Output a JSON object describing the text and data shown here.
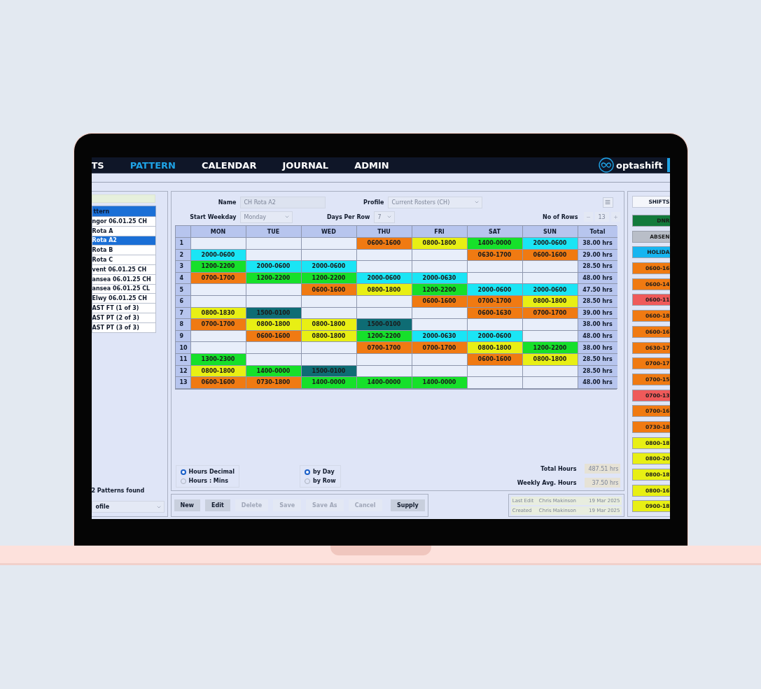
{
  "nav": {
    "items": [
      {
        "label": "TS",
        "selected": false
      },
      {
        "label": "PATTERN",
        "selected": true
      },
      {
        "label": "CALENDAR",
        "selected": false
      },
      {
        "label": "JOURNAL",
        "selected": false
      },
      {
        "label": "ADMIN",
        "selected": false
      }
    ],
    "logo": "optashift"
  },
  "pattern_list": {
    "header": "ttern",
    "items": [
      {
        "label": "ngor 06.01.25 CH",
        "selected": false
      },
      {
        "label": "Rota A",
        "selected": false
      },
      {
        "label": "Rota A2",
        "selected": true
      },
      {
        "label": "Rota B",
        "selected": false
      },
      {
        "label": "Rota C",
        "selected": false
      },
      {
        "label": "vent 06.01.25 CH",
        "selected": false
      },
      {
        "label": "ansea 06.01.25 CH",
        "selected": false
      },
      {
        "label": "ansea 06.01.25 CL",
        "selected": false
      },
      {
        "label": "Elwy 06.01.25 CH",
        "selected": false
      },
      {
        "label": "AST FT (1 of 3)",
        "selected": false
      },
      {
        "label": "AST PT (2 of 3)",
        "selected": false
      },
      {
        "label": "AST PT (3 of 3)",
        "selected": false
      }
    ],
    "count": "2 Patterns found",
    "profile_select": "ofile"
  },
  "form": {
    "name_label": "Name",
    "name": "CH Rota A2",
    "profile_label": "Profile",
    "profile": "Current Rosters (CH)",
    "start_weekday_label": "Start Weekday",
    "start_weekday": "Monday",
    "days_per_row_label": "Days Per Row",
    "days_per_row": "7",
    "rows_label": "No of Rows",
    "rows": "13"
  },
  "grid": {
    "columns": [
      "MON",
      "TUE",
      "WED",
      "THU",
      "FRI",
      "SAT",
      "SUN",
      "Total"
    ],
    "rows": [
      {
        "label": "1",
        "cells": [
          null,
          null,
          null,
          {
            "shift": "0600-1600",
            "color": "#f07a12"
          },
          {
            "shift": "0800-1800",
            "color": "#e8ef14"
          },
          {
            "shift": "1400-0000",
            "color": "#16e02a"
          },
          {
            "shift": "2000-0600",
            "color": "#1ae5f5"
          }
        ],
        "total": "38.00 hrs"
      },
      {
        "label": "2",
        "cells": [
          {
            "shift": "2000-0600",
            "color": "#1ae5f5"
          },
          null,
          null,
          null,
          null,
          {
            "shift": "0630-1700",
            "color": "#f07a12"
          },
          {
            "shift": "0600-1600",
            "color": "#f07a12"
          }
        ],
        "total": "29.00 hrs"
      },
      {
        "label": "3",
        "cells": [
          {
            "shift": "1200-2200",
            "color": "#16e02a"
          },
          {
            "shift": "2000-0600",
            "color": "#1ae5f5"
          },
          {
            "shift": "2000-0600",
            "color": "#1ae5f5"
          },
          null,
          null,
          null,
          null
        ],
        "total": "28.50 hrs"
      },
      {
        "label": "4",
        "cells": [
          {
            "shift": "0700-1700",
            "color": "#f07a12"
          },
          {
            "shift": "1200-2200",
            "color": "#16e02a"
          },
          {
            "shift": "1200-2200",
            "color": "#16e02a"
          },
          {
            "shift": "2000-0600",
            "color": "#1ae5f5"
          },
          {
            "shift": "2000-0630",
            "color": "#1ae5f5"
          },
          null,
          null
        ],
        "total": "48.00 hrs"
      },
      {
        "label": "5",
        "cells": [
          null,
          null,
          {
            "shift": "0600-1600",
            "color": "#f07a12"
          },
          {
            "shift": "0800-1800",
            "color": "#e8ef14"
          },
          {
            "shift": "1200-2200",
            "color": "#16e02a"
          },
          {
            "shift": "2000-0600",
            "color": "#1ae5f5"
          },
          {
            "shift": "2000-0600",
            "color": "#1ae5f5"
          }
        ],
        "total": "47.50 hrs"
      },
      {
        "label": "6",
        "cells": [
          null,
          null,
          null,
          null,
          {
            "shift": "0600-1600",
            "color": "#f07a12"
          },
          {
            "shift": "0700-1700",
            "color": "#f07a12"
          },
          {
            "shift": "0800-1800",
            "color": "#e8ef14"
          }
        ],
        "total": "28.50 hrs"
      },
      {
        "label": "7",
        "cells": [
          {
            "shift": "0800-1830",
            "color": "#e8ef14"
          },
          {
            "shift": "1500-0100",
            "color": "#0e6c74"
          },
          null,
          null,
          null,
          {
            "shift": "0600-1630",
            "color": "#f07a12"
          },
          {
            "shift": "0700-1700",
            "color": "#f07a12"
          }
        ],
        "total": "39.00 hrs"
      },
      {
        "label": "8",
        "cells": [
          {
            "shift": "0700-1700",
            "color": "#f07a12"
          },
          {
            "shift": "0800-1800",
            "color": "#e8ef14"
          },
          {
            "shift": "0800-1800",
            "color": "#e8ef14"
          },
          {
            "shift": "1500-0100",
            "color": "#0e6c74"
          },
          null,
          null,
          null
        ],
        "total": "38.00 hrs"
      },
      {
        "label": "9",
        "cells": [
          null,
          {
            "shift": "0600-1600",
            "color": "#f07a12"
          },
          {
            "shift": "0800-1800",
            "color": "#e8ef14"
          },
          {
            "shift": "1200-2200",
            "color": "#16e02a"
          },
          {
            "shift": "2000-0630",
            "color": "#1ae5f5"
          },
          {
            "shift": "2000-0600",
            "color": "#1ae5f5"
          },
          null
        ],
        "total": "48.00 hrs"
      },
      {
        "label": "10",
        "cells": [
          null,
          null,
          null,
          {
            "shift": "0700-1700",
            "color": "#f07a12"
          },
          {
            "shift": "0700-1700",
            "color": "#f07a12"
          },
          {
            "shift": "0800-1800",
            "color": "#e8ef14"
          },
          {
            "shift": "1200-2200",
            "color": "#16e02a"
          }
        ],
        "total": "38.00 hrs"
      },
      {
        "label": "11",
        "cells": [
          {
            "shift": "1300-2300",
            "color": "#16e02a"
          },
          null,
          null,
          null,
          null,
          {
            "shift": "0600-1600",
            "color": "#f07a12"
          },
          {
            "shift": "0800-1800",
            "color": "#e8ef14"
          }
        ],
        "total": "28.50 hrs"
      },
      {
        "label": "12",
        "cells": [
          {
            "shift": "0800-1800",
            "color": "#e8ef14"
          },
          {
            "shift": "1400-0000",
            "color": "#16e02a"
          },
          {
            "shift": "1500-0100",
            "color": "#0e6c74"
          },
          null,
          null,
          null,
          null
        ],
        "total": "28.50 hrs"
      },
      {
        "label": "13",
        "cells": [
          {
            "shift": "0600-1600",
            "color": "#f07a12"
          },
          {
            "shift": "0730-1800",
            "color": "#f07a12"
          },
          {
            "shift": "1400-0000",
            "color": "#16e02a"
          },
          {
            "shift": "1400-0000",
            "color": "#16e02a"
          },
          {
            "shift": "1400-0000",
            "color": "#16e02a"
          },
          null,
          null
        ],
        "total": "48.00 hrs"
      }
    ]
  },
  "hours_format": [
    {
      "label": "Hours Decimal",
      "selected": true
    },
    {
      "label": "Hours : Mins",
      "selected": false
    }
  ],
  "order": [
    {
      "label": "by Day",
      "selected": true
    },
    {
      "label": "by Row",
      "selected": false
    }
  ],
  "totals": [
    {
      "label": "Total Hours",
      "value": "487.51 hrs"
    },
    {
      "label": "Weekly Avg. Hours",
      "value": "37.50 hrs"
    }
  ],
  "buttons": [
    {
      "label": "New",
      "disabled": false
    },
    {
      "label": "Edit",
      "disabled": false
    },
    {
      "label": "Delete",
      "disabled": true
    },
    {
      "label": "Save",
      "disabled": true
    },
    {
      "label": "Save As",
      "disabled": true
    },
    {
      "label": "Cancel",
      "disabled": true
    },
    {
      "label": "Supply",
      "disabled": false
    }
  ],
  "audit": [
    {
      "label": "Last Edit",
      "user": "Chris Makinson",
      "date": "19 Mar 2025"
    },
    {
      "label": "Created",
      "user": "Chris Makinson",
      "date": "19 Mar 2025"
    }
  ],
  "shifts": {
    "title": "SHIFTS",
    "items": [
      {
        "label": "DNR",
        "color": "#137a3c"
      },
      {
        "label": "ABSEN",
        "color": "#b9bec8"
      },
      {
        "label": "HOLIDA",
        "color": "#16b5f0"
      },
      {
        "label": "0600-16",
        "color": "#f07a12"
      },
      {
        "label": "0600-14",
        "color": "#f07a12"
      },
      {
        "label": "0600-11",
        "color": "#ef5a5a"
      },
      {
        "label": "0600-18",
        "color": "#f07a12"
      },
      {
        "label": "0600-16",
        "color": "#f07a12"
      },
      {
        "label": "0630-17",
        "color": "#f07a12"
      },
      {
        "label": "0700-17",
        "color": "#f07a12"
      },
      {
        "label": "0700-15",
        "color": "#f07a12"
      },
      {
        "label": "0700-13",
        "color": "#ef5a5a"
      },
      {
        "label": "0700-16",
        "color": "#f07a12"
      },
      {
        "label": "0730-18",
        "color": "#f07a12"
      },
      {
        "label": "0800-18",
        "color": "#e8ef14"
      },
      {
        "label": "0800-20",
        "color": "#e8ef14"
      },
      {
        "label": "0800-18",
        "color": "#e8ef14"
      },
      {
        "label": "0800-16",
        "color": "#e8ef14"
      },
      {
        "label": "0900-18",
        "color": "#e8ef14"
      }
    ]
  }
}
